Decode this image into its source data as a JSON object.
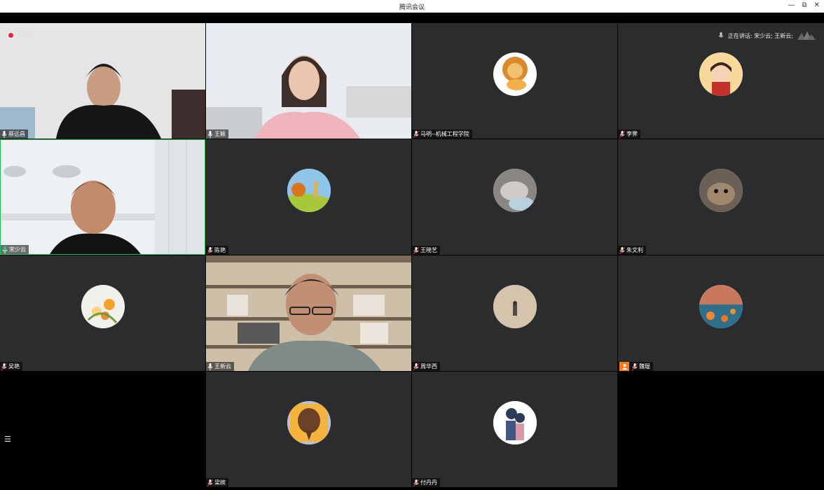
{
  "window": {
    "title": "腾讯会议",
    "controls": {
      "minimize": "—",
      "restore": "⧉",
      "close": "✕"
    }
  },
  "recording": {
    "label": "录制中"
  },
  "speaking": {
    "label": "正在讲话: 宋少云; 王新云;"
  },
  "participants": [
    {
      "name": "蔡远昌"
    },
    {
      "name": "王颖"
    },
    {
      "name": "马明--机械工程学院"
    },
    {
      "name": "李霁"
    },
    {
      "name": "宋少云"
    },
    {
      "name": "陈艳"
    },
    {
      "name": "王晓艺"
    },
    {
      "name": "朱文利"
    },
    {
      "name": "吴艳"
    },
    {
      "name": "王新云"
    },
    {
      "name": "周华西"
    },
    {
      "name": "魏琨"
    },
    {
      "name": "梁缤"
    },
    {
      "name": "付丹丹"
    }
  ],
  "colors": {
    "active_border": "#1fbf5b",
    "tile_bg": "#2b2c2e",
    "host_badge": "#ff7a1a",
    "record_dot": "#e23"
  },
  "icons": {
    "list": "☰"
  }
}
